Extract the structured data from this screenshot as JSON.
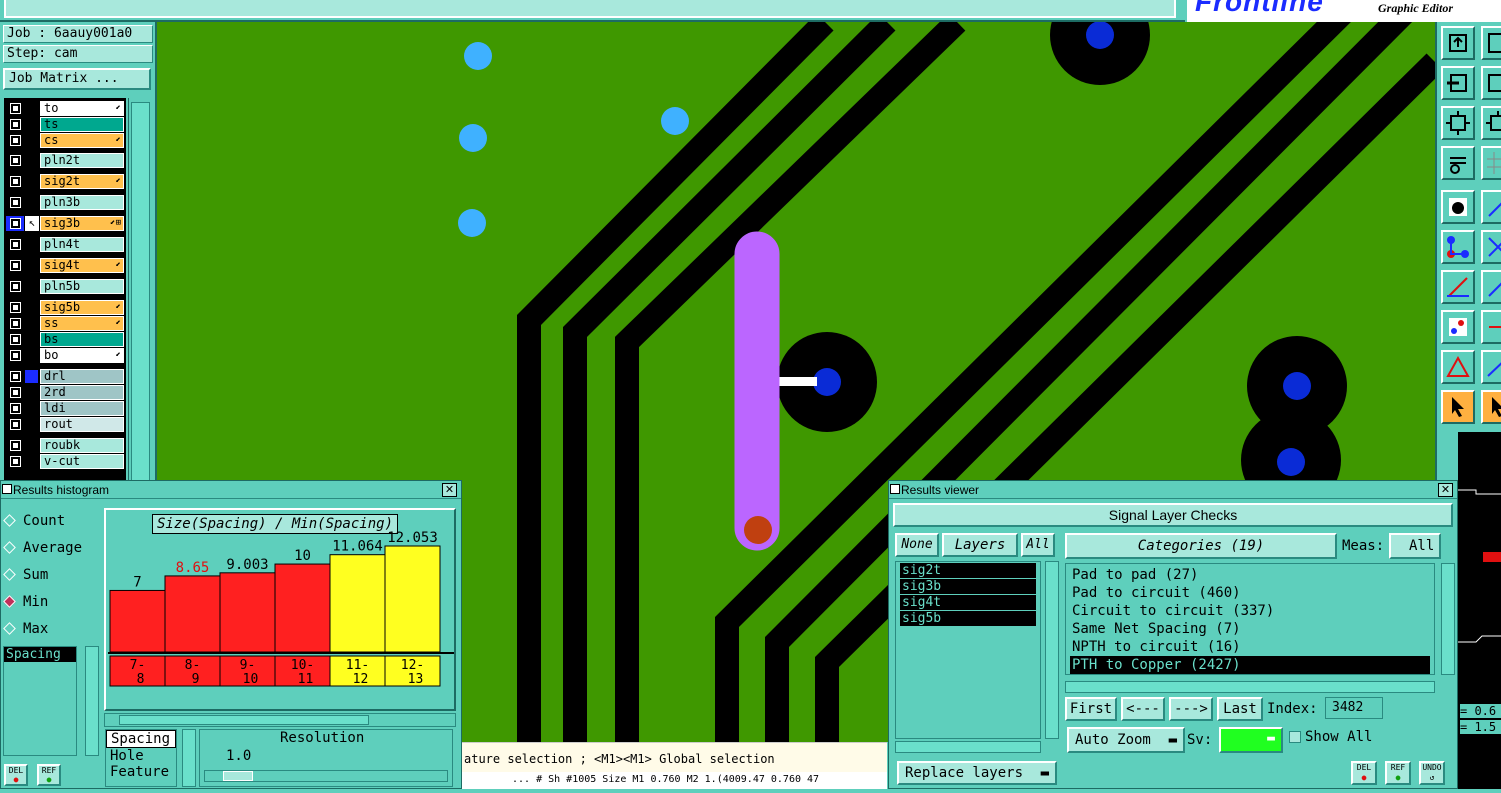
{
  "app": {
    "brand": "Frontline",
    "subtitle": "Graphic Editor"
  },
  "job": {
    "job": "Job : 6aauy001a0",
    "step": "Step: cam",
    "matrix_button": "Job Matrix ..."
  },
  "layers": [
    {
      "name": "to",
      "color": "#ffffff",
      "flag": "⬋"
    },
    {
      "name": "ts",
      "color": "#00a88f",
      "flag": ""
    },
    {
      "name": "cs",
      "color": "#ffc04d",
      "flag": "⬋"
    },
    {
      "name": "pln2t",
      "color": "#a8e8dc",
      "flag": ""
    },
    {
      "name": "sig2t",
      "color": "#ffc04d",
      "flag": "⬋"
    },
    {
      "name": "pln3b",
      "color": "#a8e8dc",
      "flag": ""
    },
    {
      "name": "sig3b",
      "color": "#ffc04d",
      "flag": "⬋⊞"
    },
    {
      "name": "pln4t",
      "color": "#a8e8dc",
      "flag": ""
    },
    {
      "name": "sig4t",
      "color": "#ffc04d",
      "flag": "⬋"
    },
    {
      "name": "pln5b",
      "color": "#a8e8dc",
      "flag": ""
    },
    {
      "name": "sig5b",
      "color": "#ffc04d",
      "flag": "⬋"
    },
    {
      "name": "ss",
      "color": "#ffc04d",
      "flag": "⬋"
    },
    {
      "name": "bs",
      "color": "#00a88f",
      "flag": ""
    },
    {
      "name": "bo",
      "color": "#ffffff",
      "flag": "⬋"
    },
    {
      "name": "drl",
      "color": "#9fc5c6",
      "flag": ""
    },
    {
      "name": "2rd",
      "color": "#9fc5c6",
      "flag": ""
    },
    {
      "name": "ldi",
      "color": "#9fc5c6",
      "flag": ""
    },
    {
      "name": "rout",
      "color": "#d0e8e8",
      "flag": ""
    },
    {
      "name": "roubk",
      "color": "#a8e8dc",
      "flag": ""
    },
    {
      "name": "v-cut",
      "color": "#a8e8dc",
      "flag": ""
    }
  ],
  "histogram": {
    "title": "Results histogram",
    "modes": [
      "Count",
      "Average",
      "Sum",
      "Min",
      "Max"
    ],
    "selected_mode": "Min",
    "list_item": "Spacing",
    "chart_title": "Size(Spacing) / Min(Spacing)",
    "bins": [
      {
        "label": "7-\n8",
        "value": "7",
        "height": 7,
        "color": "#ff2020",
        "value_color": "#000"
      },
      {
        "label": "8-\n9",
        "value": "8.65",
        "height": 8.65,
        "color": "#ff2020",
        "value_color": "#e01010"
      },
      {
        "label": "9-\n10",
        "value": "9.003",
        "height": 9.003,
        "color": "#ff2020",
        "value_color": "#000"
      },
      {
        "label": "10-\n11",
        "value": "10",
        "height": 10,
        "color": "#ff2020",
        "value_color": "#000"
      },
      {
        "label": "11-\n12",
        "value": "11.064",
        "height": 11.064,
        "color": "#ffff20",
        "value_color": "#000"
      },
      {
        "label": "12-\n13",
        "value": "12.053",
        "height": 12.053,
        "color": "#ffff20",
        "value_color": "#000"
      }
    ],
    "bottom_list": [
      "Spacing",
      "Hole",
      "Feature"
    ],
    "resolution_label": "Resolution",
    "resolution_value": "1.0"
  },
  "status": {
    "line1": "ature selection ; <M1><M1> Global selection",
    "line2": "... # Sh #1005 Size M1 0.760 M2 1.(4009.47 0.760 47"
  },
  "results": {
    "title": "Results viewer",
    "header": "Signal Layer Checks",
    "none_btn": "None",
    "layers_tab": "Layers",
    "all_btn": "All",
    "categories_tab": "Categories (19)",
    "meas_label": "Meas:",
    "meas_value": "All",
    "layers": [
      "sig2t",
      "sig3b",
      "sig4t",
      "sig5b"
    ],
    "categories": [
      "Pad to pad (27)",
      "Pad to circuit (460)",
      "Circuit to circuit (337)",
      "Same Net Spacing (7)",
      "NPTH to circuit (16)",
      "PTH to Copper (2427)"
    ],
    "selected_category": 5,
    "first": "First",
    "prev": "<---",
    "next": "--->",
    "last": "Last",
    "index_label": "Index:",
    "index_value": "3482",
    "auto_zoom": "Auto Zoom",
    "sv_label": "Sv:",
    "show_all": "Show All",
    "replace_layers": "Replace layers"
  },
  "footer_buttons": {
    "del": "DEL",
    "ref": "REF",
    "undo": "UNDO"
  },
  "right_edge": {
    "line1": "= 0.6",
    "line2": "= 1.5"
  }
}
